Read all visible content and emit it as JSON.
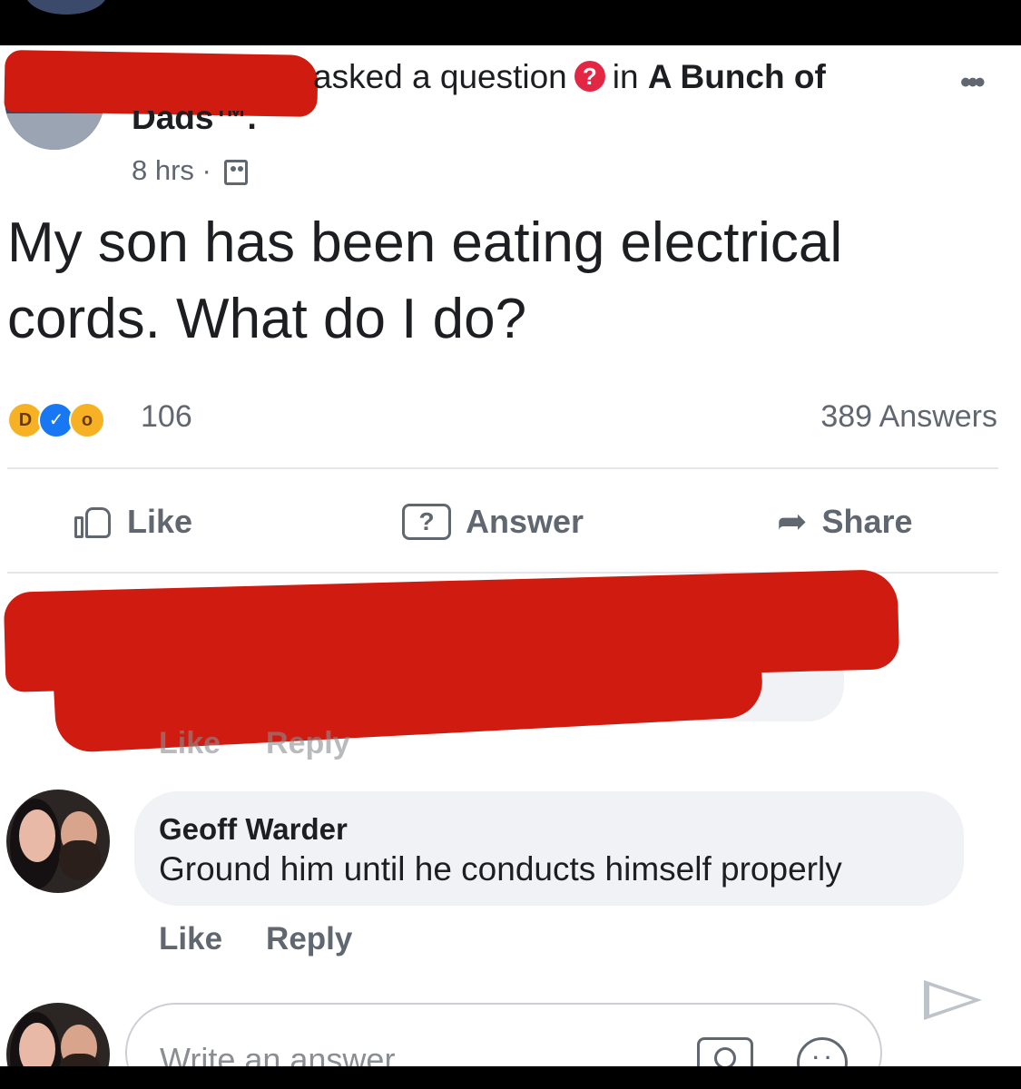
{
  "post": {
    "action_text": "asked a question",
    "group_prefix": "in ",
    "group_name": "A Bunch of",
    "group_name_cont": "Dads™.",
    "time": "8 hrs",
    "separator": " · ",
    "question": "My son has been eating electrical cords. What do I do?",
    "reaction_count": "106",
    "answers_count": "389 Answers",
    "reactions": [
      "haha",
      "like",
      "wow"
    ]
  },
  "actions": {
    "like": "Like",
    "answer": "Answer",
    "share": "Share"
  },
  "redacted_comment": {
    "like": "Like",
    "reply": "Reply"
  },
  "comment": {
    "author": "Geoff Warder",
    "text": "Ground him until he conducts himself properly",
    "like": "Like",
    "reply": "Reply"
  },
  "composer": {
    "placeholder": "Write an answer..."
  },
  "icons": {
    "question_badge": "question-mark-icon",
    "group": "group-icon",
    "more": "more-options-icon",
    "like": "thumbs-up-icon",
    "answer": "question-bubble-icon",
    "share": "share-arrow-icon",
    "camera": "camera-icon",
    "emoji": "emoji-icon",
    "send": "send-icon"
  },
  "colors": {
    "question_badge": "#e42645",
    "like_blue": "#1877f2",
    "redaction": "#d01c10"
  }
}
